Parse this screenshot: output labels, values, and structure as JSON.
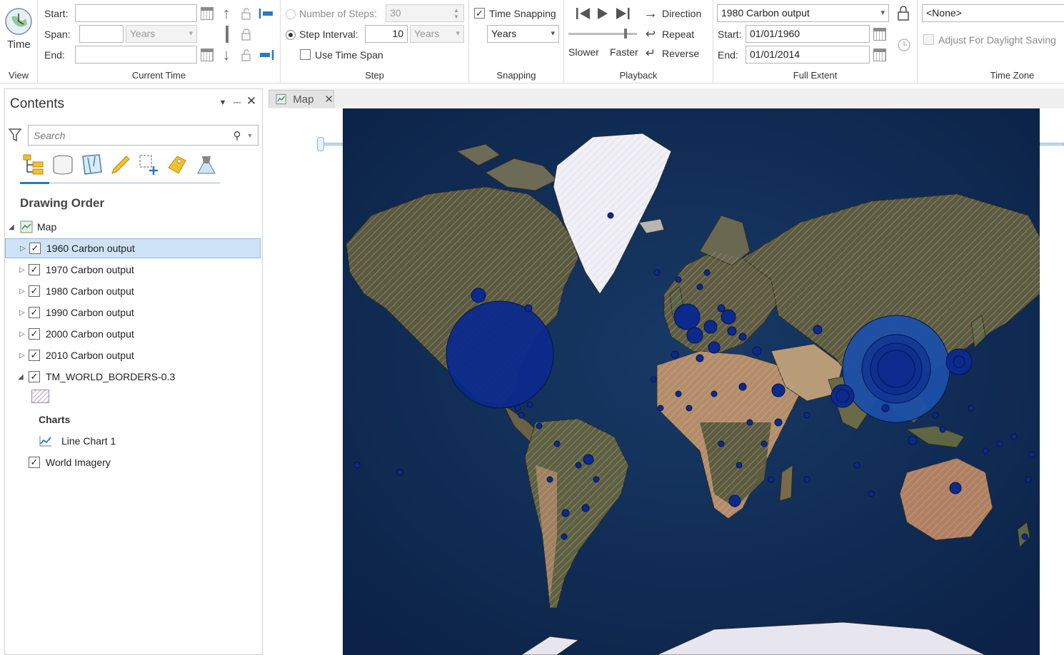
{
  "ribbon": {
    "view": {
      "time_label": "Time",
      "group_label": "View"
    },
    "current_time": {
      "start_label": "Start:",
      "start_value": "",
      "span_label": "Span:",
      "span_value": "",
      "span_unit": "Years",
      "end_label": "End:",
      "end_value": "",
      "group_label": "Current Time"
    },
    "step": {
      "num_steps_label": "Number of Steps:",
      "num_steps_value": "30",
      "step_interval_label": "Step Interval:",
      "step_interval_value": "10",
      "step_interval_unit": "Years",
      "use_time_span_label": "Use Time Span",
      "group_label": "Step"
    },
    "snapping": {
      "time_snapping_label": "Time Snapping",
      "unit": "Years",
      "group_label": "Snapping"
    },
    "playback": {
      "direction_label": "Direction",
      "repeat_label": "Repeat",
      "reverse_label": "Reverse",
      "slower_label": "Slower",
      "faster_label": "Faster",
      "speed_fraction": 0.85,
      "group_label": "Playback"
    },
    "full_extent": {
      "layer": "1980 Carbon output",
      "start_label": "Start:",
      "start_value": "01/01/1960",
      "end_label": "End:",
      "end_value": "01/01/2014",
      "group_label": "Full Extent"
    },
    "time_zone": {
      "value": "<None>",
      "dst_label": "Adjust For Daylight Saving",
      "group_label": "Time Zone"
    }
  },
  "contents": {
    "title": "Contents",
    "search_placeholder": "Search",
    "drawing_order_label": "Drawing Order",
    "map_label": "Map",
    "layers": [
      {
        "name": "1960 Carbon output",
        "checked": true
      },
      {
        "name": "1970 Carbon output",
        "checked": true
      },
      {
        "name": "1980 Carbon output",
        "checked": true
      },
      {
        "name": "1990 Carbon output",
        "checked": true
      },
      {
        "name": "2000 Carbon output",
        "checked": true
      },
      {
        "name": "2010 Carbon output",
        "checked": true
      }
    ],
    "borders_layer": "TM_WORLD_BORDERS-0.3",
    "charts_label": "Charts",
    "chart_item": "Line Chart 1",
    "imagery_layer": "World Imagery"
  },
  "map": {
    "tab_label": "Map"
  },
  "colors": {
    "accent": "#2a78c8",
    "ocean": "#0f2a52",
    "symbol": "#0b2a8c",
    "land": "#5e5a3a",
    "desert": "#a98b6c"
  }
}
